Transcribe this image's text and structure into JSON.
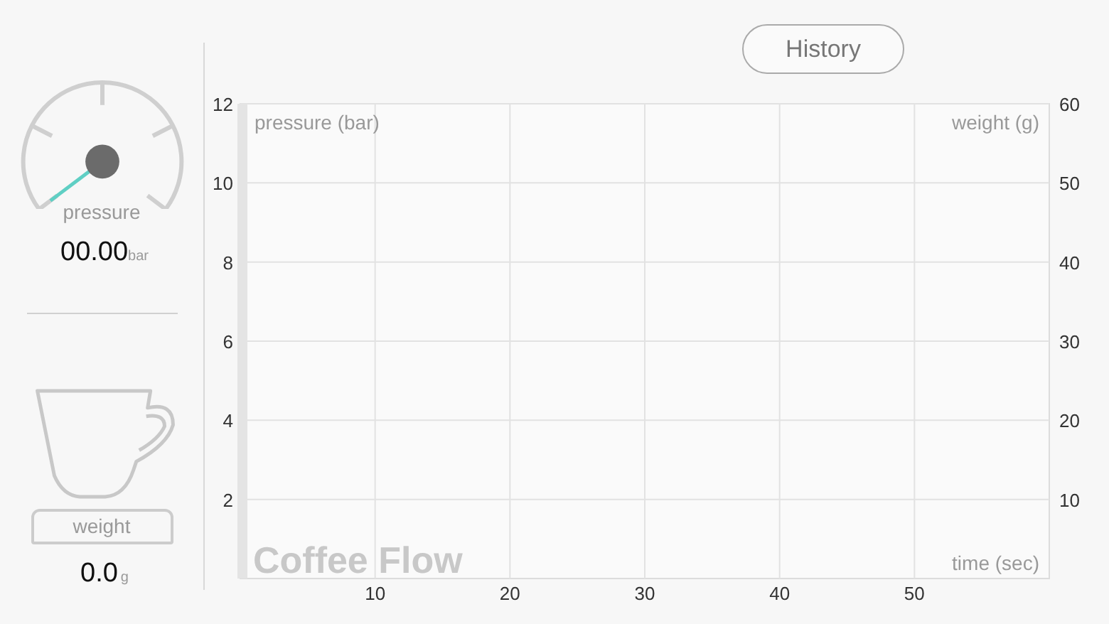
{
  "gauge": {
    "label": "pressure",
    "value": "00.00",
    "unit": "bar"
  },
  "scale": {
    "label": "weight",
    "value": "0.0",
    "unit": "g"
  },
  "history_button": {
    "label": "History"
  },
  "chart": {
    "title": "Coffee Flow",
    "chart_data": {
      "type": "line",
      "grid": true,
      "y2label": "weight (g)",
      "y2lim": [
        0,
        60
      ],
      "y2ticks": [
        10,
        20,
        30,
        40,
        50,
        60
      ],
      "xlabel": "time (sec)",
      "ylabel": "pressure (bar)",
      "xlim": [
        0,
        60
      ],
      "ylim": [
        0,
        12
      ],
      "xticks": [
        10,
        20,
        30,
        40,
        50
      ],
      "yticks": [
        2,
        4,
        6,
        8,
        10,
        12
      ]
    }
  }
}
